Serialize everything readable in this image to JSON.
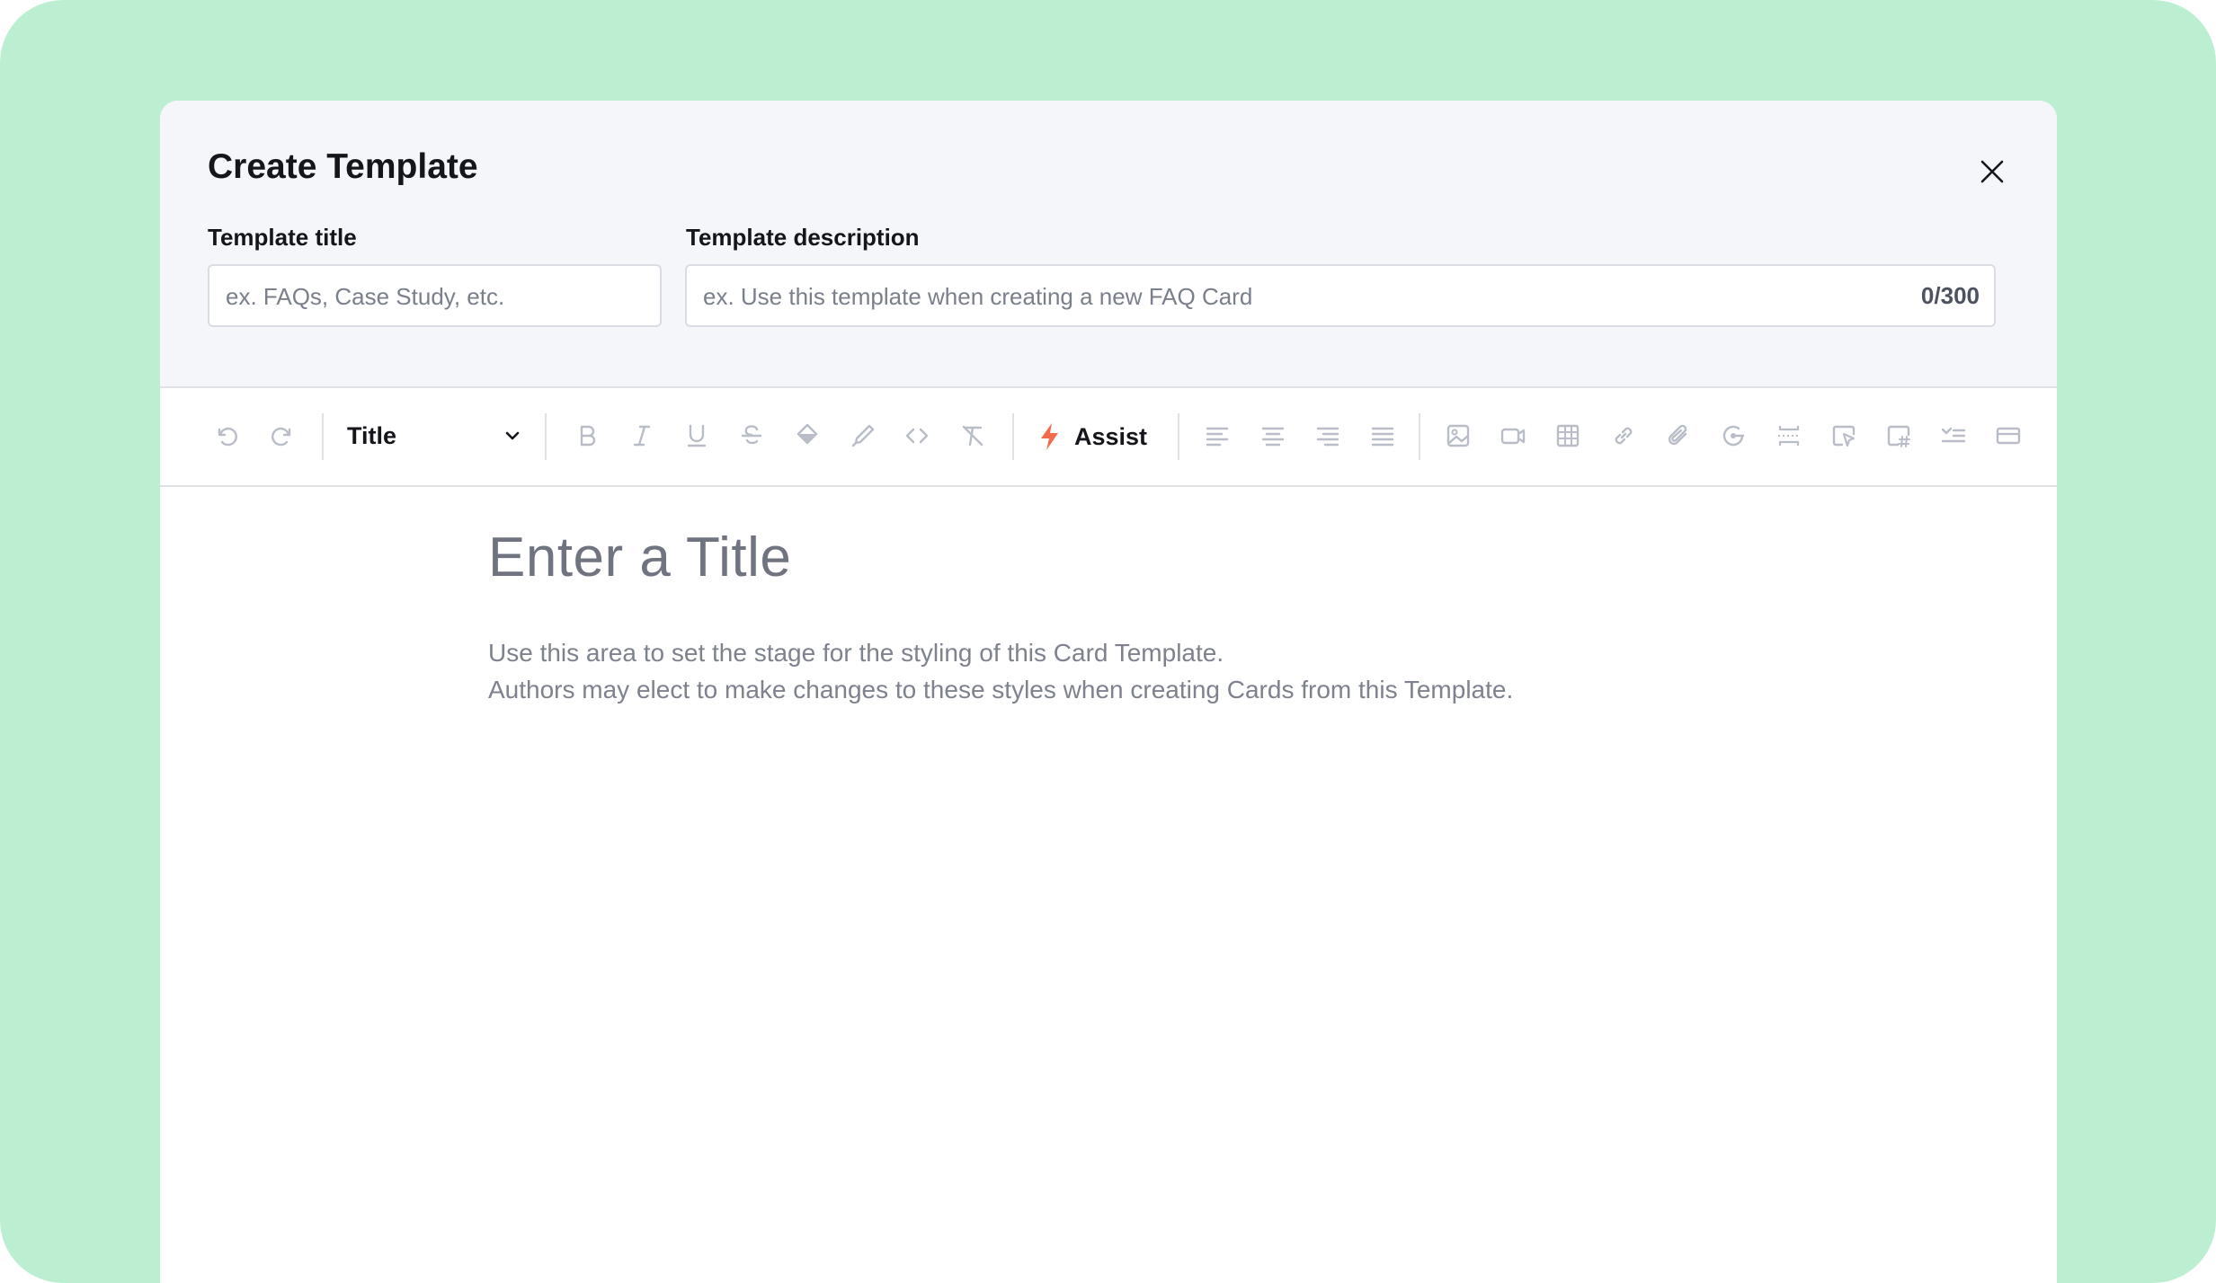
{
  "modal": {
    "title": "Create Template",
    "close_icon": "close-icon"
  },
  "form": {
    "title_label": "Template title",
    "title_placeholder": "ex. FAQs, Case Study, etc.",
    "title_value": "",
    "description_label": "Template description",
    "description_placeholder": "ex. Use this template when creating a new FAQ Card",
    "description_value": "",
    "description_counter": "0/300"
  },
  "toolbar": {
    "text_style": "Title",
    "assist_label": "Assist",
    "icons": [
      "undo-icon",
      "redo-icon",
      "chevron-down-icon",
      "bold-icon",
      "italic-icon",
      "underline-icon",
      "strikethrough-icon",
      "highlight-icon",
      "text-color-icon",
      "code-icon",
      "clear-format-icon",
      "lightning-icon",
      "align-left-icon",
      "align-center-icon",
      "align-right-icon",
      "align-justify-icon",
      "image-icon",
      "video-icon",
      "table-icon",
      "link-icon",
      "attachment-icon",
      "loop-icon",
      "divider-icon",
      "cursor-card-icon",
      "card-hash-icon",
      "checklist-icon",
      "collapse-icon"
    ]
  },
  "editor": {
    "title_placeholder": "Enter a Title",
    "body_line1": "Use this area to set the stage for the styling of this Card Template.",
    "body_line2": "Authors may elect to make changes to these styles when creating Cards from this Template."
  },
  "colors": {
    "background": "#bcefd2",
    "header": "#f5f6fa",
    "accent_assist": "#f26a4b",
    "icon_gray": "#b9bdc7"
  }
}
